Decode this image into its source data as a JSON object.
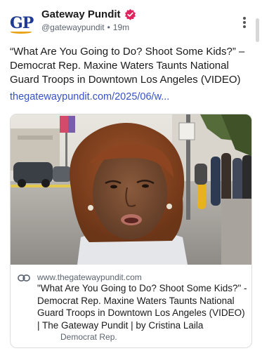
{
  "account": {
    "display_name": "Gateway Pundit",
    "handle": "@gatewaypundit",
    "separator": "•",
    "time_ago": "19m",
    "avatar_text": "GP",
    "verified_color": "#e0245e"
  },
  "post": {
    "text": "“What Are You Going to Do? Shoot Some Kids?” – Democrat Rep. Maxine Waters Taunts National Guard Troops in Downtown Los Angeles (VIDEO)",
    "link": "thegatewaypundit.com/2025/06/w..."
  },
  "card": {
    "image_icon": "video-still-photo",
    "domain": "www.thegatewaypundit.com",
    "title": "\"What Are You Going to Do? Shoot Some Kids?\" - Democrat Rep. Maxine Waters Taunts National Guard Troops in Downtown Los Angeles (VIDEO) | The Gateway Pundit | by Cristina Laila",
    "tag": "Democrat Rep."
  },
  "icons": {
    "more": "more-vertical-icon",
    "link": "link-icon",
    "verified": "verified-badge-icon"
  },
  "colors": {
    "link": "#3651c8",
    "brand_blue": "#1f3a93",
    "brand_gold": "#e8a317"
  }
}
